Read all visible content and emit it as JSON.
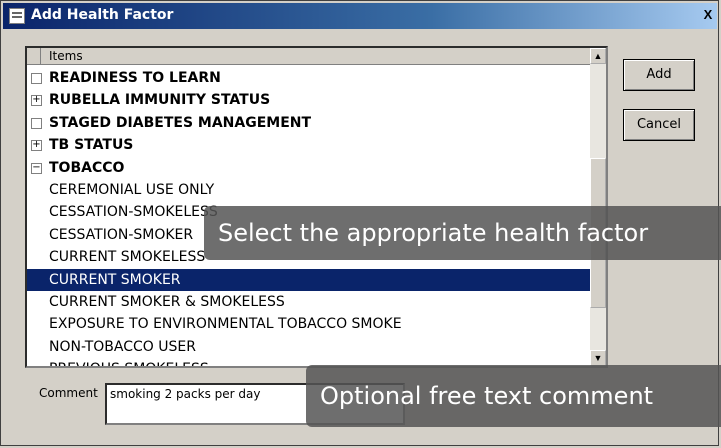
{
  "window": {
    "title": "Add Health Factor",
    "close_label": "X"
  },
  "list": {
    "header": "Items",
    "rows": [
      {
        "label": "READINESS TO LEARN",
        "toggle": "",
        "parent": true,
        "selected": false
      },
      {
        "label": "RUBELLA IMMUNITY STATUS",
        "toggle": "+",
        "parent": true,
        "selected": false
      },
      {
        "label": "STAGED DIABETES MANAGEMENT",
        "toggle": "",
        "parent": true,
        "selected": false
      },
      {
        "label": "TB STATUS",
        "toggle": "+",
        "parent": true,
        "selected": false
      },
      {
        "label": "TOBACCO",
        "toggle": "−",
        "parent": true,
        "selected": false
      },
      {
        "label": "CEREMONIAL USE ONLY",
        "toggle": null,
        "parent": false,
        "selected": false
      },
      {
        "label": "CESSATION-SMOKELESS",
        "toggle": null,
        "parent": false,
        "selected": false
      },
      {
        "label": "CESSATION-SMOKER",
        "toggle": null,
        "parent": false,
        "selected": false
      },
      {
        "label": "CURRENT SMOKELESS",
        "toggle": null,
        "parent": false,
        "selected": false
      },
      {
        "label": "CURRENT SMOKER",
        "toggle": null,
        "parent": false,
        "selected": true
      },
      {
        "label": "CURRENT SMOKER & SMOKELESS",
        "toggle": null,
        "parent": false,
        "selected": false
      },
      {
        "label": "EXPOSURE TO ENVIRONMENTAL TOBACCO SMOKE",
        "toggle": null,
        "parent": false,
        "selected": false
      },
      {
        "label": "NON-TOBACCO USER",
        "toggle": null,
        "parent": false,
        "selected": false
      },
      {
        "label": "PREVIOUS SMOKELESS",
        "toggle": null,
        "parent": false,
        "selected": false
      }
    ]
  },
  "buttons": {
    "add": "Add",
    "cancel": "Cancel"
  },
  "comment": {
    "label": "Comment",
    "value": "smoking 2 packs per day"
  },
  "callouts": {
    "select": "Select the appropriate health factor",
    "comment": "Optional free text comment"
  },
  "icons": {
    "title_icon": "window-icon",
    "scroll_up": "scroll-up-arrow-icon",
    "scroll_down": "scroll-down-arrow-icon"
  }
}
